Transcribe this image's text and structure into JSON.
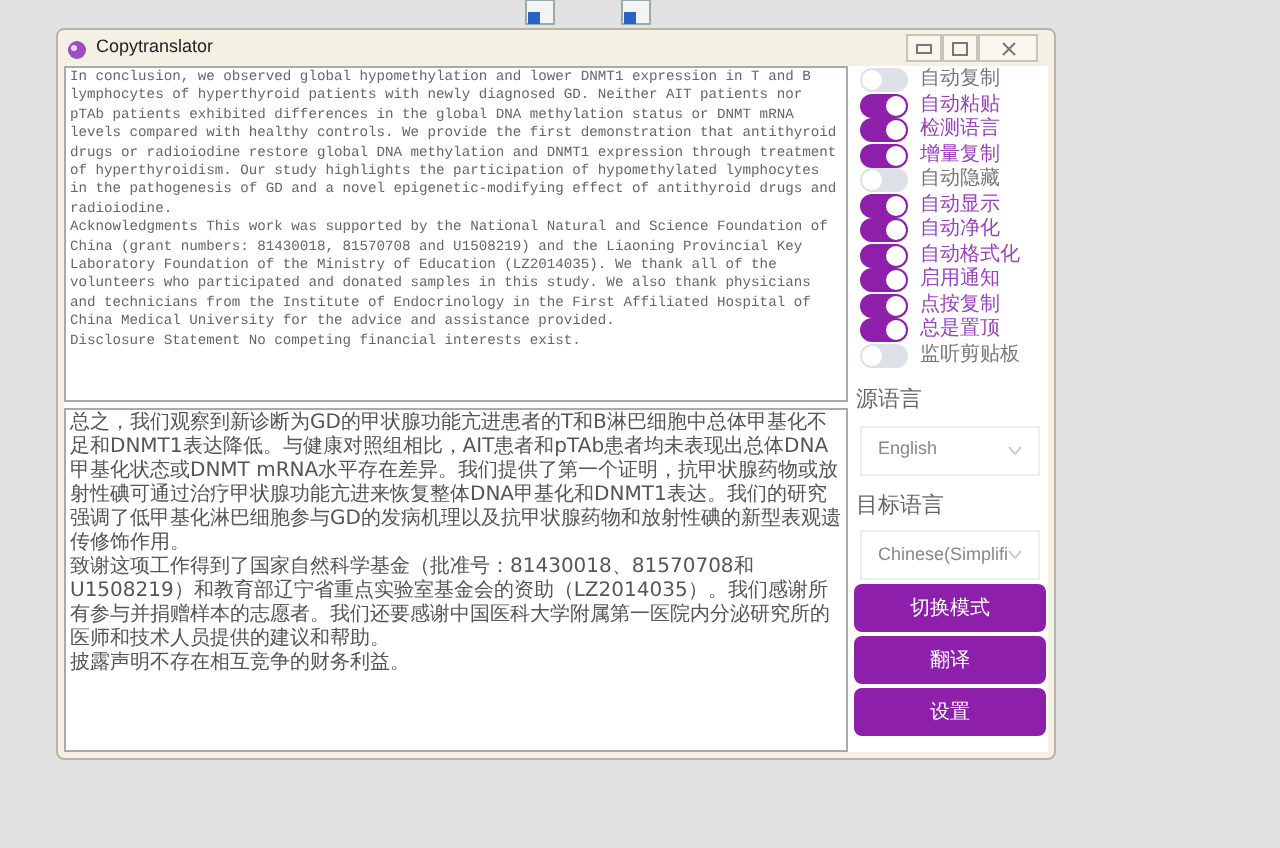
{
  "window": {
    "title": "Copytranslator"
  },
  "source_text": [
    "In conclusion, we observed global hypomethylation and lower DNMT1 expression in T and B lymphocytes of hyperthyroid patients with newly diagnosed GD. Neither AIT patients nor pTAb patients exhibited differences in the global DNA methylation status or DNMT mRNA levels compared with healthy controls. We provide the first demonstration that antithyroid drugs or radioiodine restore global DNA methylation and DNMT1 expression through treatment of hyperthyroidism. Our study highlights the participation of hypomethylated lymphocytes in the pathogenesis of GD and a novel epigenetic-modifying effect of antithyroid drugs and radioiodine.",
    "Acknowledgments This work was supported by the National Natural and Science Foundation of China (grant numbers: 81430018, 81570708 and U1508219) and the Liaoning Provincial Key Laboratory Foundation of the Ministry of Education (LZ2014035). We thank all of the volunteers who participated and donated samples in this study. We also thank physicians and technicians from the Institute of Endocrinology in the First Affiliated Hospital of China Medical University for the advice and assistance provided.",
    "Disclosure Statement No competing financial interests exist."
  ],
  "target_text": [
    "总之，我们观察到新诊断为GD的甲状腺功能亢进患者的T和B淋巴细胞中总体甲基化不足和DNMT1表达降低。与健康对照组相比，AIT患者和pTAb患者均未表现出总体DNA甲基化状态或DNMT mRNA水平存在差异。我们提供了第一个证明，抗甲状腺药物或放射性碘可通过治疗甲状腺功能亢进来恢复整体DNA甲基化和DNMT1表达。我们的研究强调了低甲基化淋巴细胞参与GD的发病机理以及抗甲状腺药物和放射性碘的新型表观遗传修饰作用。",
    "致谢这项工作得到了国家自然科学基金（批准号：81430018、81570708和U1508219）和教育部辽宁省重点实验室基金会的资助（LZ2014035）。我们感谢所有参与并捐赠样本的志愿者。我们还要感谢中国医科大学附属第一医院内分泌研究所的医师和技术人员提供的建议和帮助。",
    "披露声明不存在相互竞争的财务利益。"
  ],
  "switches": [
    {
      "label": "自动复制",
      "on": false
    },
    {
      "label": "自动粘贴",
      "on": true
    },
    {
      "label": "检测语言",
      "on": true
    },
    {
      "label": "增量复制",
      "on": true
    },
    {
      "label": "自动隐藏",
      "on": false
    },
    {
      "label": "自动显示",
      "on": true
    },
    {
      "label": "自动净化",
      "on": true
    },
    {
      "label": "自动格式化",
      "on": true
    },
    {
      "label": "启用通知",
      "on": true
    },
    {
      "label": "点按复制",
      "on": true
    },
    {
      "label": "总是置顶",
      "on": true
    },
    {
      "label": "监听剪贴板",
      "on": false
    }
  ],
  "source_language": {
    "label": "源语言",
    "value": "English"
  },
  "target_language": {
    "label": "目标语言",
    "value": "Chinese(Simplifi"
  },
  "buttons": [
    "切换模式",
    "翻译",
    "设置"
  ]
}
